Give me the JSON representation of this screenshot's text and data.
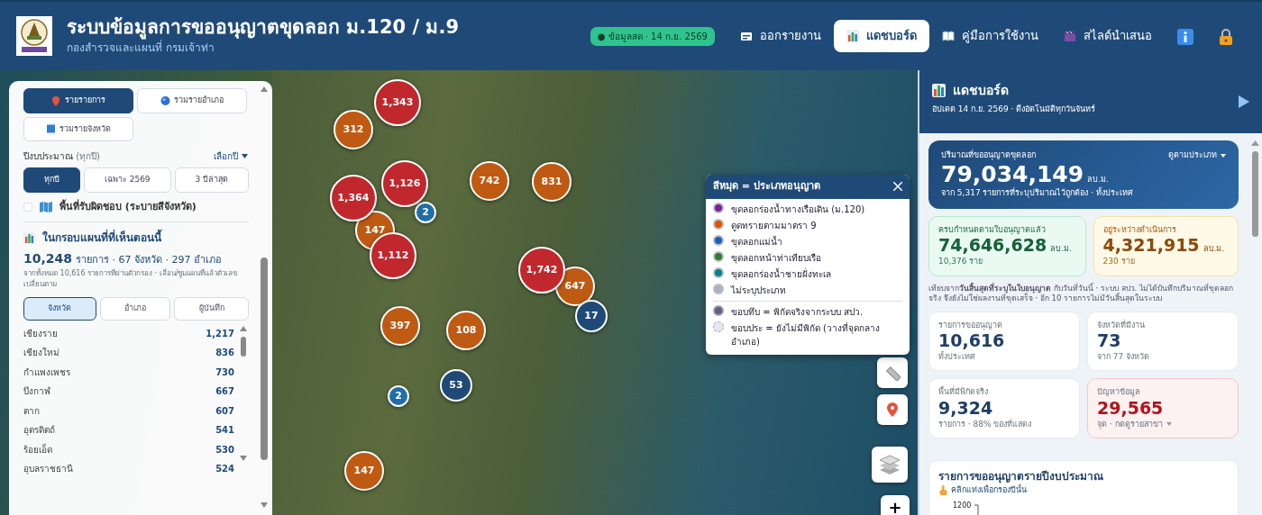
{
  "header": {
    "title": "ระบบข้อมูลการขออนุญาตขุดลอก ม.120 / ม.9",
    "subtitle": "กองสำรวจและแผนที่ กรมเจ้าท่า",
    "live_badge": "● ข้อมูลสด · 14 ก.ย. 2569",
    "nav": [
      {
        "label": "ออกรายงาน",
        "selected": false
      },
      {
        "label": "แดชบอร์ด",
        "selected": true
      },
      {
        "label": "คู่มือการใช้งาน",
        "selected": false
      },
      {
        "label": "สไลด์นำเสนอ",
        "selected": false
      }
    ]
  },
  "side_panel": {
    "view_modes": [
      {
        "label": "รายรายการ",
        "selected": true
      },
      {
        "label": "รวมรายอำเภอ",
        "selected": false
      },
      {
        "label": "รวมรายจังหวัด",
        "selected": false
      }
    ],
    "fiscal_year": {
      "label": "ปีงบประมาณ",
      "note": "(ทุกปี)",
      "picker": "เลือกปี",
      "options": [
        {
          "label": "ทุกปี",
          "selected": true
        },
        {
          "label": "เฉพาะ 2569",
          "selected": false
        },
        {
          "label": "3 ปีล่าสุด",
          "selected": false
        }
      ]
    },
    "responsibility": {
      "label": "พื้นที่รับผิดชอบ (ระบายสีจังหวัด)",
      "checked": false
    },
    "in_view": {
      "title": "ในกรอบแผนที่ที่เห็นตอนนี้",
      "count": "10,248",
      "summary": "รายการ · 67 จังหวัด · 297 อำเภอ",
      "note": "จากทั้งหมด 10,616 รายการที่ผ่านตัวกรอง · เลื่อน/ซูมแผนที่แล้วตัวเลขเปลี่ยนตาม"
    },
    "group_tabs": [
      {
        "label": "จังหวัด",
        "selected": true
      },
      {
        "label": "อำเภอ",
        "selected": false
      },
      {
        "label": "ผู้บันทึก",
        "selected": false
      }
    ],
    "rows": [
      {
        "name": "เชียงราย",
        "count": "1,217"
      },
      {
        "name": "เชียงใหม่",
        "count": "836"
      },
      {
        "name": "กำแพงเพชร",
        "count": "730"
      },
      {
        "name": "บึงกาฬ",
        "count": "667"
      },
      {
        "name": "ตาก",
        "count": "607"
      },
      {
        "name": "อุตรดิตถ์",
        "count": "541"
      },
      {
        "name": "ร้อยเอ็ด",
        "count": "530"
      },
      {
        "name": "อุบลราชธานี",
        "count": "524"
      }
    ]
  },
  "map": {
    "clusters": [
      {
        "label": "1,343",
        "color": "#c0282d"
      },
      {
        "label": "312",
        "color": "#bf5a12"
      },
      {
        "label": "1,364",
        "color": "#c0282d"
      },
      {
        "label": "1,126",
        "color": "#c0282d"
      },
      {
        "label": "2",
        "color": "#1f6fa6"
      },
      {
        "label": "742",
        "color": "#bf5a12"
      },
      {
        "label": "831",
        "color": "#bf5a12"
      },
      {
        "label": "147",
        "color": "#bf5a12"
      },
      {
        "label": "1,112",
        "color": "#c0282d"
      },
      {
        "label": "1,742",
        "color": "#c0282d"
      },
      {
        "label": "647",
        "color": "#bf5a12"
      },
      {
        "label": "17",
        "color": "#1f4a78"
      },
      {
        "label": "397",
        "color": "#bf5a12"
      },
      {
        "label": "108",
        "color": "#bf5a12"
      },
      {
        "label": "53",
        "color": "#1f4a78"
      },
      {
        "label": "2",
        "color": "#1f6fa6"
      },
      {
        "label": "147",
        "color": "#bf5a12"
      }
    ],
    "legend": {
      "title": "สีหมุด = ประเภทอนุญาต",
      "items": [
        {
          "kind": "type",
          "label": "ขุดลอกร่องน้ำทางเรือเดิน (ม.120)",
          "color": "#7b1fa2"
        },
        {
          "kind": "type",
          "label": "ดูดทรายตามมาตรา 9",
          "color": "#e65100"
        },
        {
          "kind": "type",
          "label": "ขุดลอกแม่น้ำ",
          "color": "#1565c0"
        },
        {
          "kind": "type",
          "label": "ขุดลอกหน้าท่าเทียบเรือ",
          "color": "#2e7d32"
        },
        {
          "kind": "type",
          "label": "ขุดลอกร่องน้ำชายฝั่งทะเล",
          "color": "#00838f"
        },
        {
          "kind": "type",
          "label": "ไม่ระบุประเภท",
          "color": "#a9b3c4"
        },
        {
          "kind": "solid",
          "label": "ขอบทึบ = พิกัดจริงจากระบบ สปว."
        },
        {
          "kind": "dashed",
          "label": "ขอบประ = ยังไม่มีพิกัด (วางที่จุดกลางอำเภอ)"
        }
      ]
    },
    "zoom_in": "+"
  },
  "dashboard": {
    "title": "แดชบอร์ด",
    "updated": "อัปเดต 14 ก.ย. 2569 · ดึงอัตโนมัติทุกวันจันทร์",
    "volume": {
      "label": "ปริมาณที่ขออนุญาตขุดลอก",
      "picker": "ดูตามประเภท",
      "value": "79,034,149",
      "unit": "ลบ.ม.",
      "note": "จาก 5,317 รายการที่ระบุปริมาณไว้ถูกต้อง · ทั้งประเทศ"
    },
    "progress": [
      {
        "kind": "done",
        "label": "ครบกำหนดตามใบอนุญาตแล้ว",
        "value": "74,646,628",
        "unit": "ลบ.ม.",
        "sub": "10,376 ราย"
      },
      {
        "kind": "pending",
        "label": "อยู่ระหว่างดำเนินการ",
        "value": "4,321,915",
        "unit": "ลบ.ม.",
        "sub": "230 ราย"
      }
    ],
    "explain": "เทียบจาก**วันสิ้นสุดที่ระบุในใบอนุญาต** กับวันที่วันนี้ · ระบบ สปว. ไม่ได้บันทึกปริมาณที่ขุดลอกจริง จึงยังไม่ใช่ผลงานที่ขุดเสร็จ · อีก 10 รายการไม่มีวันสิ้นสุดในระบบ",
    "stats": [
      {
        "kind": "plain",
        "label": "รายการขออนุญาต",
        "value": "10,616",
        "sub": "ทั้งประเทศ"
      },
      {
        "kind": "plain",
        "label": "จังหวัดที่มีงาน",
        "value": "73",
        "sub": "จาก 77 จังหวัด"
      },
      {
        "kind": "plain",
        "label": "พื้นที่มีพิกัดจริง",
        "value": "9,324",
        "sub": "รายการ · 88% ของที่แสดง"
      },
      {
        "kind": "alert",
        "label": "ปัญหาข้อมูล",
        "value": "29,565",
        "sub": "จุด · กดดูรายสาขา"
      }
    ],
    "chart": {
      "title": "รายการขออนุญาตรายปีงบประมาณ",
      "hint": "คลิกแท่งเพื่อกรองปีนั้น",
      "y_tick": "1200"
    }
  }
}
